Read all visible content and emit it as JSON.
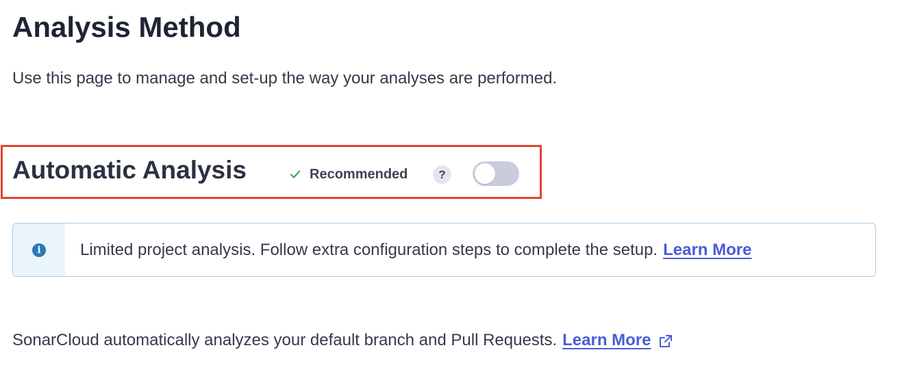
{
  "page": {
    "title": "Analysis Method",
    "description": "Use this page to manage and set-up the way your analyses are performed."
  },
  "automatic_analysis": {
    "title": "Automatic Analysis",
    "recommended_label": "Recommended",
    "help_icon": "question-mark-icon",
    "help_glyph": "?",
    "toggle_enabled": false,
    "highlight_color": "#e5432f"
  },
  "info_banner": {
    "icon": "info-icon",
    "icon_glyph": "i",
    "message": "Limited project analysis. Follow extra configuration steps to complete the setup.",
    "link_label": "Learn More"
  },
  "footer": {
    "message": "SonarCloud automatically analyzes your default branch and Pull Requests.",
    "link_label": "Learn More",
    "link_icon": "external-link-icon"
  },
  "colors": {
    "accent_link": "#4b5bd6",
    "check_green": "#3ca45b",
    "toggle_off": "#c9ccdd",
    "info_blue": "#2e78b8"
  }
}
